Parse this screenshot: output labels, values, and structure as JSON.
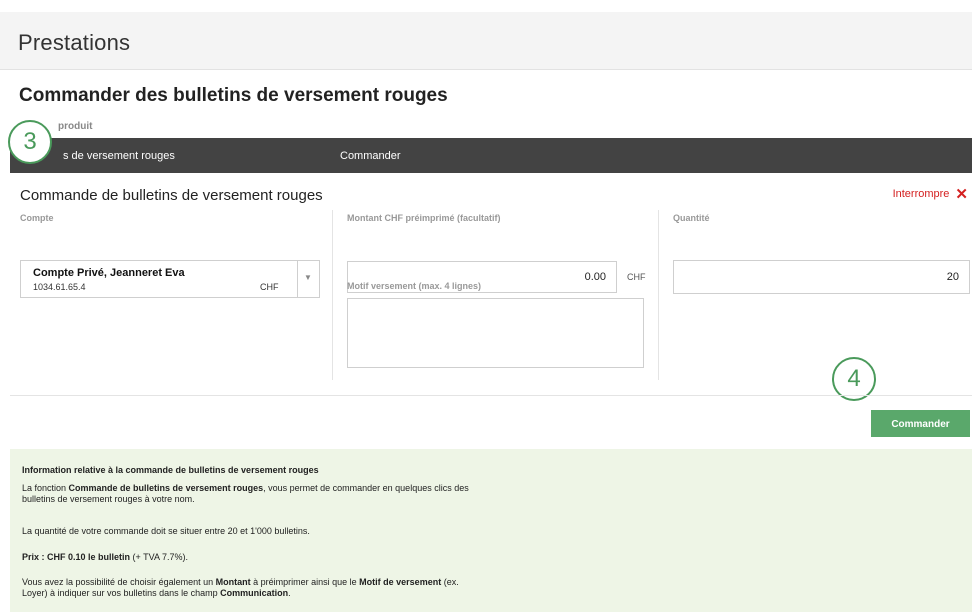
{
  "topbar": {
    "title": "Prestations"
  },
  "page": {
    "title": "Commander des bulletins de versement rouges"
  },
  "steps": {
    "header_label": "produit",
    "step1": "s de versement rouges",
    "step2": "Commander"
  },
  "annotations": {
    "circle3": "3",
    "circle4": "4"
  },
  "form": {
    "title": "Commande de bulletins de versement rouges",
    "interrupt_label": "Interrompre",
    "account": {
      "label": "Compte",
      "name": "Compte Privé, Jeanneret Eva",
      "number": "1034.61.65.4",
      "currency": "CHF"
    },
    "amount": {
      "label": "Montant CHF préimprimé (facultatif)",
      "value": "0.00",
      "currency": "CHF"
    },
    "motif": {
      "label": "Motif versement (max. 4 lignes)",
      "value": ""
    },
    "quantity": {
      "label": "Quantité",
      "value": "20"
    },
    "order_button": "Commander"
  },
  "info": {
    "heading": "Information relative à la commande de bulletins de versement rouges",
    "p1_pre": "La fonction ",
    "p1_bold": "Commande de bulletins de versement rouges",
    "p1_post": ", vous permet de commander en quelques clics des bulletins de versement rouges à votre nom.",
    "p2": "La quantité de votre commande doit se situer entre 20 et 1'000 bulletins.",
    "p3_bold": "Prix : CHF 0.10 le bulletin",
    "p3_post": " (+ TVA 7.7%).",
    "p4_a": "Vous avez la possibilité de choisir également un ",
    "p4_b": "Montant",
    "p4_c": " à préimprimer ainsi que le ",
    "p4_d": "Motif de versement",
    "p4_e": " (ex. Loyer) à indiquer sur vos bulletins dans le champ ",
    "p4_f": "Communication",
    "p4_g": "."
  },
  "colors": {
    "accent_green": "#5aa86b",
    "stepbar": "#434343",
    "interrupt_red": "#d42020",
    "info_bg": "#eef5e6"
  }
}
